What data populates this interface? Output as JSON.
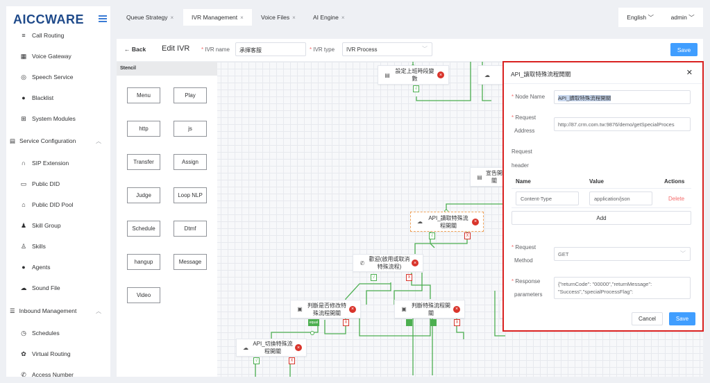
{
  "app": {
    "logo_a": "AICC",
    "logo_b": "WARE"
  },
  "sidebar": {
    "items": [
      {
        "label": "Call Routing",
        "icon": "menu-lines-icon"
      },
      {
        "label": "Voice Gateway",
        "icon": "calendar-grid-icon"
      },
      {
        "label": "Speech Service",
        "icon": "headset-circle-icon"
      },
      {
        "label": "Blacklist",
        "icon": "user-icon"
      },
      {
        "label": "System Modules",
        "icon": "grid-icon"
      },
      {
        "label": "Service Configuration",
        "icon": "card-icon",
        "group": true
      },
      {
        "label": "SIP Extension",
        "icon": "headphones-icon"
      },
      {
        "label": "Public DID",
        "icon": "folder-icon"
      },
      {
        "label": "Public DID Pool",
        "icon": "home-icon"
      },
      {
        "label": "Skill Group",
        "icon": "user-badge-icon"
      },
      {
        "label": "Skills",
        "icon": "person-outline-icon"
      },
      {
        "label": "Agents",
        "icon": "user-icon"
      },
      {
        "label": "Sound File",
        "icon": "cloud-icon"
      },
      {
        "label": "Inbound Management",
        "icon": "list-icon",
        "group": true
      },
      {
        "label": "Schedules",
        "icon": "clock-icon"
      },
      {
        "label": "Virtual Routing",
        "icon": "gear-icon"
      },
      {
        "label": "Access Number",
        "icon": "phone-icon"
      }
    ]
  },
  "tabs": [
    {
      "label": "Queue Strategy"
    },
    {
      "label": "IVR Management",
      "active": true
    },
    {
      "label": "Voice Files"
    },
    {
      "label": "AI Engine"
    }
  ],
  "top_right": {
    "language": "English",
    "user": "admin"
  },
  "editor": {
    "back_label": "Back",
    "title": "Edit IVR",
    "ivr_name_label": "IVR name",
    "ivr_name_value": "承揮客服",
    "ivr_type_label": "IVR type",
    "ivr_type_value": "IVR Process",
    "save_label": "Save"
  },
  "stencil": {
    "title": "Stencil",
    "items": [
      "Menu",
      "Play",
      "http",
      "js",
      "Transfer",
      "Assign",
      "Judge",
      "Loop NLP",
      "Schedule",
      "Dtmf",
      "hangup",
      "Message",
      "Video"
    ]
  },
  "nodes": {
    "n1": "設定上班時段變數",
    "n2": "宣告開關",
    "n3": "API_讀取特殊流程開關",
    "n4": "歡迎(啟用或取消特殊流程)",
    "n5": "判斷是否修改特殊流程開關",
    "n6": "判斷特殊流程開關",
    "n7": "API_切換特殊流程開關",
    "port_equal": "equal"
  },
  "panel": {
    "title": "API_讀取特殊流程開關",
    "node_name_label": "Node Name",
    "node_name_value": "API_讀取特殊流程開關",
    "request_address_label_1": "Request",
    "request_address_label_2": "Address",
    "request_address_value": "http://87.crm.com.tw:9876/demo/getSpecialProces",
    "request_header_label_1": "Request",
    "request_header_label_2": "header",
    "col_name": "Name",
    "col_value": "Value",
    "col_actions": "Actions",
    "header_name": "Content-Type",
    "header_value": "application/json",
    "delete_label": "Delete",
    "add_label": "Add",
    "method_label_1": "Request",
    "method_label_2": "Method",
    "method_value": "GET",
    "response_label_1": "Response",
    "response_label_2": "parameters",
    "response_value_1": "{\"returnCode\": \"00000\",\"returnMessage\":",
    "response_value_2": "\"Success\",\"specialProcessFlag\":",
    "cancel_label": "Cancel",
    "save_label": "Save"
  },
  "colors": {
    "accent": "#409eff",
    "danger": "#d9201f",
    "flow": "#4caf50"
  }
}
